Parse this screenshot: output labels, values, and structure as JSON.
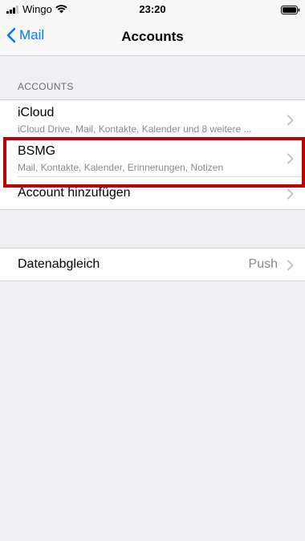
{
  "status_bar": {
    "carrier": "Wingo",
    "time": "23:20"
  },
  "nav": {
    "back_label": "Mail",
    "title": "Accounts"
  },
  "accounts_section": {
    "header": "ACCOUNTS",
    "items": [
      {
        "title": "iCloud",
        "subtitle": "iCloud Drive, Mail, Kontakte, Kalender und 8 weitere ..."
      },
      {
        "title": "BSMG",
        "subtitle": "Mail, Kontakte, Kalender, Erinnerungen, Notizen"
      },
      {
        "title": "Account hinzufügen"
      }
    ]
  },
  "fetch_section": {
    "label": "Datenabgleich",
    "value": "Push"
  },
  "colors": {
    "accent": "#007aff",
    "highlight": "#c00000",
    "background": "#efeff4"
  }
}
